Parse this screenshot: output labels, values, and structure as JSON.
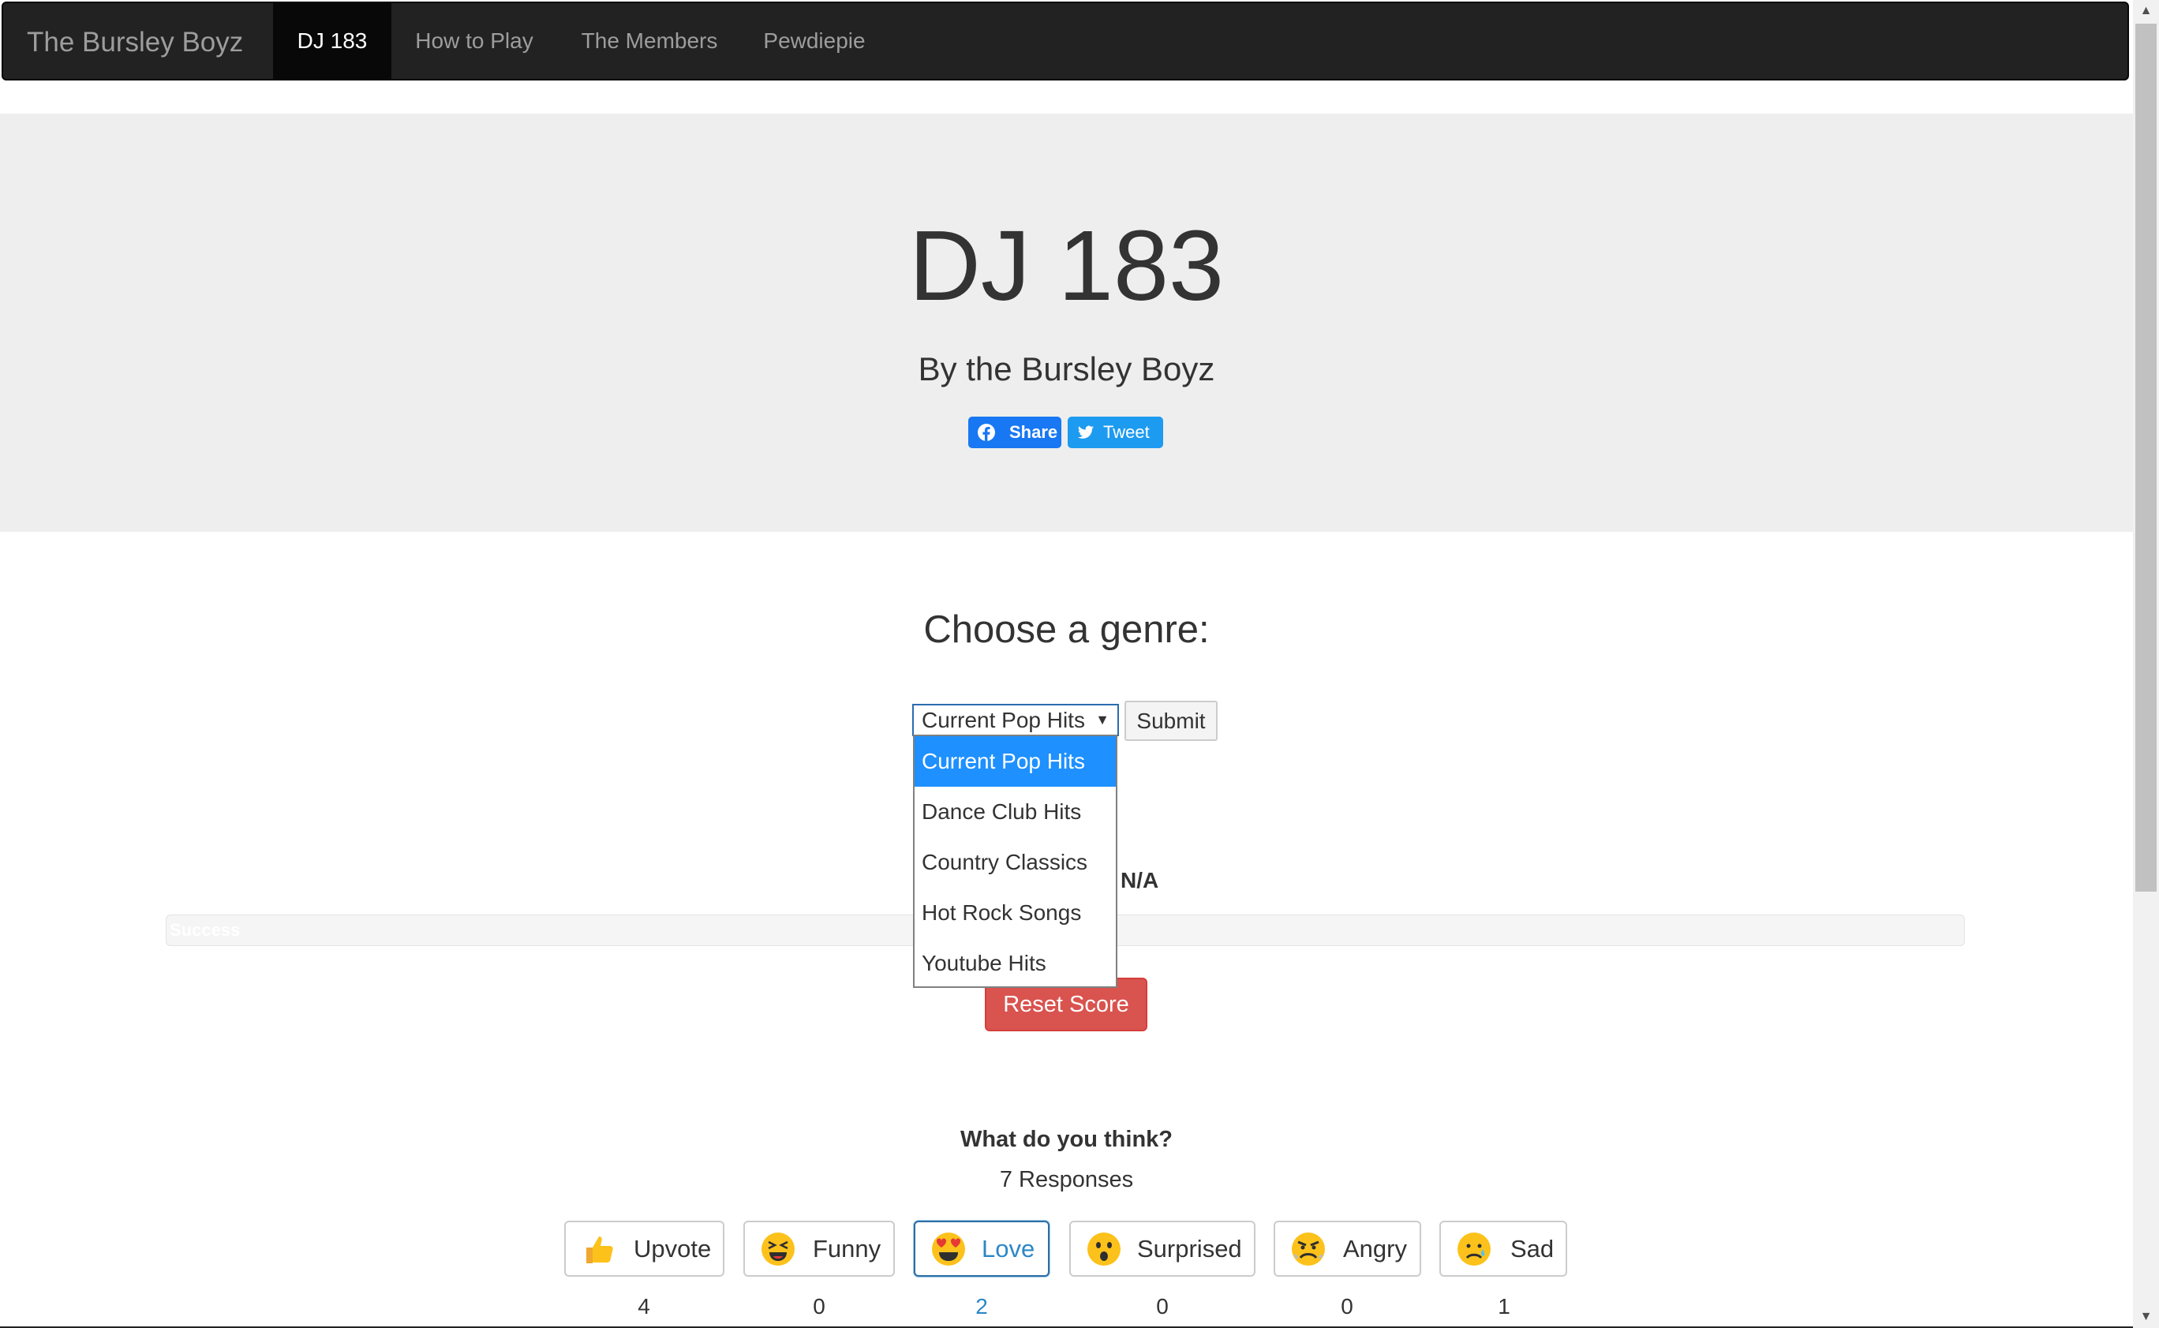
{
  "navbar": {
    "brand": "The Bursley Boyz",
    "items": [
      {
        "label": "DJ 183",
        "active": true
      },
      {
        "label": "How to Play",
        "active": false
      },
      {
        "label": "The Members",
        "active": false
      },
      {
        "label": "Pewdiepie",
        "active": false
      }
    ]
  },
  "jumbotron": {
    "title": "DJ 183",
    "subtitle": "By the Bursley Boyz",
    "share_label": "Share",
    "tweet_label": "Tweet"
  },
  "genre": {
    "heading": "Choose a genre:",
    "selected": "Current Pop Hits",
    "options": [
      "Current Pop Hits",
      "Dance Club Hits",
      "Country Classics",
      "Hot Rock Songs",
      "Youtube Hits"
    ],
    "submit_label": "Submit"
  },
  "score": {
    "value": "N/A",
    "progress_text": "Success",
    "reset_label": "Reset Score"
  },
  "reactions": {
    "title": "What do you think?",
    "responses": "7 Responses",
    "items": [
      {
        "label": "Upvote",
        "count": "4",
        "icon": "thumbs-up-icon"
      },
      {
        "label": "Funny",
        "count": "0",
        "icon": "laughing-face-icon"
      },
      {
        "label": "Love",
        "count": "2",
        "icon": "heart-eyes-icon",
        "active": true
      },
      {
        "label": "Surprised",
        "count": "0",
        "icon": "surprised-face-icon"
      },
      {
        "label": "Angry",
        "count": "0",
        "icon": "angry-face-icon"
      },
      {
        "label": "Sad",
        "count": "1",
        "icon": "sad-face-icon"
      }
    ]
  },
  "colors": {
    "navbar_bg": "#222222",
    "jumbotron_bg": "#eeeeee",
    "facebook": "#1877f2",
    "twitter": "#1d9bf0",
    "danger": "#d9534f",
    "select_highlight": "#1e90ff",
    "active_reaction": "#2b87c8"
  }
}
